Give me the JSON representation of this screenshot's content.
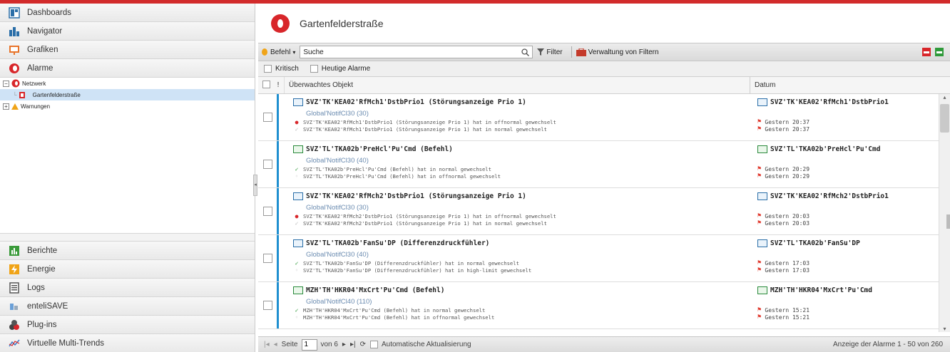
{
  "sidebar": {
    "top_items": [
      {
        "label": "Dashboards",
        "icon": "dashboard-icon"
      },
      {
        "label": "Navigator",
        "icon": "navigator-icon"
      },
      {
        "label": "Grafiken",
        "icon": "graphics-icon"
      },
      {
        "label": "Alarme",
        "icon": "alarm-icon"
      }
    ],
    "tree": [
      {
        "label": "Netzwerk",
        "expander": "−"
      },
      {
        "label": "Gartenfelderstraße"
      },
      {
        "label": "Warnungen",
        "expander": "+"
      }
    ],
    "bottom_items": [
      {
        "label": "Berichte",
        "icon": "reports-icon"
      },
      {
        "label": "Energie",
        "icon": "energy-icon"
      },
      {
        "label": "Logs",
        "icon": "logs-icon"
      },
      {
        "label": "enteliSAVE",
        "icon": "entelisave-icon"
      },
      {
        "label": "Plug-ins",
        "icon": "plugins-icon"
      },
      {
        "label": "Virtuelle Multi-Trends",
        "icon": "multi-trends-icon"
      }
    ]
  },
  "header": {
    "title": "Gartenfelderstraße"
  },
  "toolbar": {
    "command_label": "Befehl",
    "search_value": "Suche",
    "filter_label": "Filter",
    "manage_filters_label": "Verwaltung von Filtern"
  },
  "filters": {
    "critical_label": "Kritisch",
    "today_label": "Heutige Alarme"
  },
  "grid": {
    "col_flag": "!",
    "col_object": "Überwachtes Objekt",
    "col_date": "Datum",
    "rows": [
      {
        "title": "SVZ'TK'KEA02'RfMch1'DstbPrio1 (Störungsanzeige Prio 1)",
        "class": "Global'NotifCl30 (30)",
        "events": [
          {
            "icon": "●",
            "text": "SVZ'TK'KEA02'RfMch1'DstbPrio1 (Störungsanzeige Prio 1) hat in offnormal gewechselt"
          },
          {
            "icon": "✓",
            "text": "SVZ'TK'KEA02'RfMch1'DstbPrio1 (Störungsanzeige Prio 1) hat in normal gewechselt"
          }
        ],
        "date_obj": "SVZ'TK'KEA02'RfMch1'DstbPrio1",
        "dates": [
          "Gestern 20:37",
          "Gestern 20:37"
        ]
      },
      {
        "title": "SVZ'TL'TKA02b'PreHcl'Pu'Cmd (Befehl)",
        "class": "Global'NotifCl30 (40)",
        "events": [
          {
            "icon": "✓",
            "text": "SVZ'TL'TKA02b'PreHcl'Pu'Cmd (Befehl) hat in normal gewechselt"
          },
          {
            "icon": "◦",
            "text": "SVZ'TL'TKA02b'PreHcl'Pu'Cmd (Befehl) hat in offnormal gewechselt"
          }
        ],
        "date_obj": "SVZ'TL'TKA02b'PreHcl'Pu'Cmd",
        "dates": [
          "Gestern 20:29",
          "Gestern 20:29"
        ]
      },
      {
        "title": "SVZ'TK'KEA02'RfMch2'DstbPrio1 (Störungsanzeige Prio 1)",
        "class": "Global'NotifCl30 (30)",
        "events": [
          {
            "icon": "●",
            "text": "SVZ'TK'KEA02'RfMch2'DstbPrio1 (Störungsanzeige Prio 1) hat in offnormal gewechselt"
          },
          {
            "icon": "✓",
            "text": "SVZ'TK'KEA02'RfMch2'DstbPrio1 (Störungsanzeige Prio 1) hat in normal gewechselt"
          }
        ],
        "date_obj": "SVZ'TK'KEA02'RfMch2'DstbPrio1",
        "dates": [
          "Gestern 20:03",
          "Gestern 20:03"
        ]
      },
      {
        "title": "SVZ'TL'TKA02b'FanSu'DP (Differenzdruckfühler)",
        "class": "Global'NotifCl30 (40)",
        "events": [
          {
            "icon": "✓",
            "text": "SVZ'TL'TKA02b'FanSu'DP (Differenzdruckfühler) hat in normal gewechselt"
          },
          {
            "icon": "◦",
            "text": "SVZ'TL'TKA02b'FanSu'DP (Differenzdruckfühler) hat in high-limit gewechselt"
          }
        ],
        "date_obj": "SVZ'TL'TKA02b'FanSu'DP",
        "dates": [
          "Gestern 17:03",
          "Gestern 17:03"
        ]
      },
      {
        "title": "MZH'TH'HKR04'MxCrt'Pu'Cmd (Befehl)",
        "class": "Global'NotifCl40 (110)",
        "events": [
          {
            "icon": "✓",
            "text": "MZH'TH'HKR04'MxCrt'Pu'Cmd (Befehl) hat in normal gewechselt"
          },
          {
            "icon": "◦",
            "text": "MZH'TH'HKR04'MxCrt'Pu'Cmd (Befehl) hat in offnormal gewechselt"
          }
        ],
        "date_obj": "MZH'TH'HKR04'MxCrt'Pu'Cmd",
        "dates": [
          "Gestern 15:21",
          "Gestern 15:21"
        ]
      }
    ]
  },
  "pager": {
    "page_label": "Seite",
    "page_value": "1",
    "of_label": "von 6",
    "auto_refresh_label": "Automatische Aktualisierung",
    "status": "Anzeige der Alarme 1 - 50 von 260"
  },
  "colors": {
    "accent": "#d22b2b",
    "row_bar": "#1f8fd0",
    "class_text": "#6a8bb0"
  }
}
